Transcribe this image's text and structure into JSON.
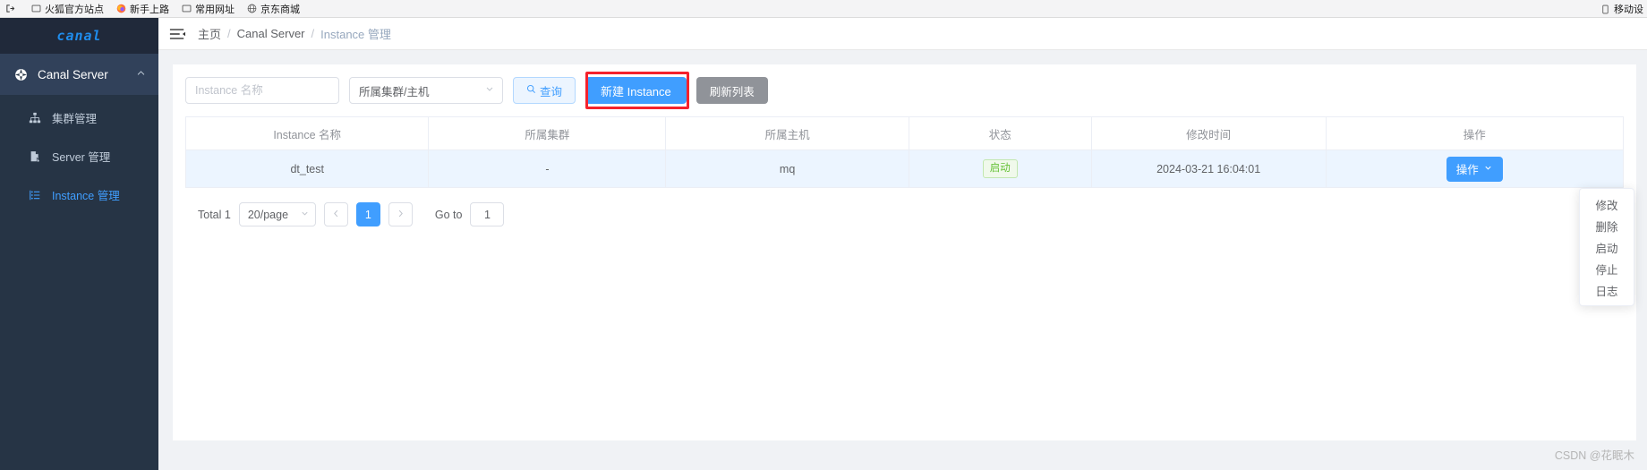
{
  "browser": {
    "bookmarks": [
      {
        "icon": "import-icon",
        "label": ""
      },
      {
        "icon": "folder-icon",
        "label": "火狐官方站点"
      },
      {
        "icon": "firefox-icon",
        "label": "新手上路"
      },
      {
        "icon": "folder-icon",
        "label": "常用网址"
      },
      {
        "icon": "globe-icon",
        "label": "京东商城"
      }
    ],
    "right_bookmark": {
      "icon": "mobile-icon",
      "label": "移动设"
    }
  },
  "sidebar": {
    "logo": "canal",
    "group": {
      "label": "Canal Server",
      "icon": "compass-icon",
      "chevron": "chevron-up-icon"
    },
    "items": [
      {
        "label": "集群管理",
        "icon": "sitemap-icon",
        "active": false
      },
      {
        "label": "Server 管理",
        "icon": "document-edit-icon",
        "active": false
      },
      {
        "label": "Instance 管理",
        "icon": "list-icon",
        "active": true
      }
    ]
  },
  "topbar": {
    "menu_toggle_icon": "hamburger-icon",
    "breadcrumb": [
      "主页",
      "Canal Server",
      "Instance 管理"
    ],
    "separator": "/"
  },
  "toolbar": {
    "search_placeholder": "Instance 名称",
    "search_value": "",
    "cluster_select_value": "所属集群/主机",
    "query_label": "查询",
    "query_icon": "search-icon",
    "create_label": "新建 Instance",
    "refresh_label": "刷新列表",
    "highlight_color": "#f5222d"
  },
  "table": {
    "columns": [
      "Instance 名称",
      "所属集群",
      "所属主机",
      "状态",
      "修改时间",
      "操作"
    ],
    "rows": [
      {
        "name": "dt_test",
        "cluster": "-",
        "host": "mq",
        "status": "启动",
        "modified": "2024-03-21 16:04:01",
        "action_label": "操作",
        "action_icon": "chevron-down-icon"
      }
    ]
  },
  "dropdown": {
    "items": [
      "修改",
      "删除",
      "启动",
      "停止",
      "日志"
    ]
  },
  "pagination": {
    "total_label": "Total 1",
    "page_size": "20/page",
    "prev_icon": "chevron-left-icon",
    "next_icon": "chevron-right-icon",
    "current_page": "1",
    "goto_label": "Go to",
    "goto_value": "1"
  },
  "watermark": "CSDN @花眠木",
  "colors": {
    "primary": "#409eff",
    "sidebar_bg": "#263445",
    "success": "#67c23a",
    "highlight": "#f5222d"
  }
}
